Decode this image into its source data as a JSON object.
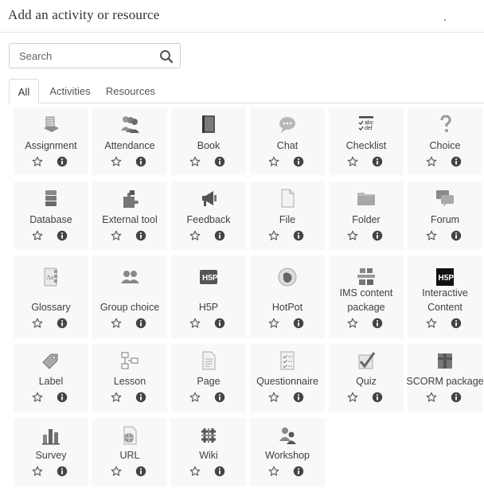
{
  "dialog": {
    "title": "Add an activity or resource"
  },
  "search": {
    "placeholder": "Search"
  },
  "tabs": [
    {
      "label": "All",
      "active": true
    },
    {
      "label": "Activities",
      "active": false
    },
    {
      "label": "Resources",
      "active": false
    }
  ],
  "items": [
    {
      "label": "Assignment",
      "icon": "assignment-icon"
    },
    {
      "label": "Attendance",
      "icon": "attendance-icon"
    },
    {
      "label": "Book",
      "icon": "book-icon"
    },
    {
      "label": "Chat",
      "icon": "chat-icon"
    },
    {
      "label": "Checklist",
      "icon": "checklist-icon"
    },
    {
      "label": "Choice",
      "icon": "choice-icon"
    },
    {
      "label": "Database",
      "icon": "database-icon"
    },
    {
      "label": "External tool",
      "icon": "external-tool-icon"
    },
    {
      "label": "Feedback",
      "icon": "feedback-icon"
    },
    {
      "label": "File",
      "icon": "file-icon"
    },
    {
      "label": "Folder",
      "icon": "folder-icon"
    },
    {
      "label": "Forum",
      "icon": "forum-icon"
    },
    {
      "label": "Glossary",
      "icon": "glossary-icon"
    },
    {
      "label": "Group choice",
      "icon": "group-choice-icon"
    },
    {
      "label": "H5P",
      "icon": "h5p-icon"
    },
    {
      "label": "HotPot",
      "icon": "hotpot-icon"
    },
    {
      "label": "IMS content package",
      "icon": "ims-content-package-icon"
    },
    {
      "label": "Interactive Content",
      "icon": "interactive-content-icon"
    },
    {
      "label": "Label",
      "icon": "label-icon"
    },
    {
      "label": "Lesson",
      "icon": "lesson-icon"
    },
    {
      "label": "Page",
      "icon": "page-icon"
    },
    {
      "label": "Questionnaire",
      "icon": "questionnaire-icon"
    },
    {
      "label": "Quiz",
      "icon": "quiz-icon"
    },
    {
      "label": "SCORM package",
      "icon": "scorm-package-icon"
    },
    {
      "label": "Survey",
      "icon": "survey-icon"
    },
    {
      "label": "URL",
      "icon": "url-icon"
    },
    {
      "label": "Wiki",
      "icon": "wiki-icon"
    },
    {
      "label": "Workshop",
      "icon": "workshop-icon"
    }
  ],
  "checklist_icon_text": {
    "line1": "abc",
    "line2": "def"
  },
  "h5p_icon_text": "H5P",
  "glossary_icon_text": "Aa"
}
